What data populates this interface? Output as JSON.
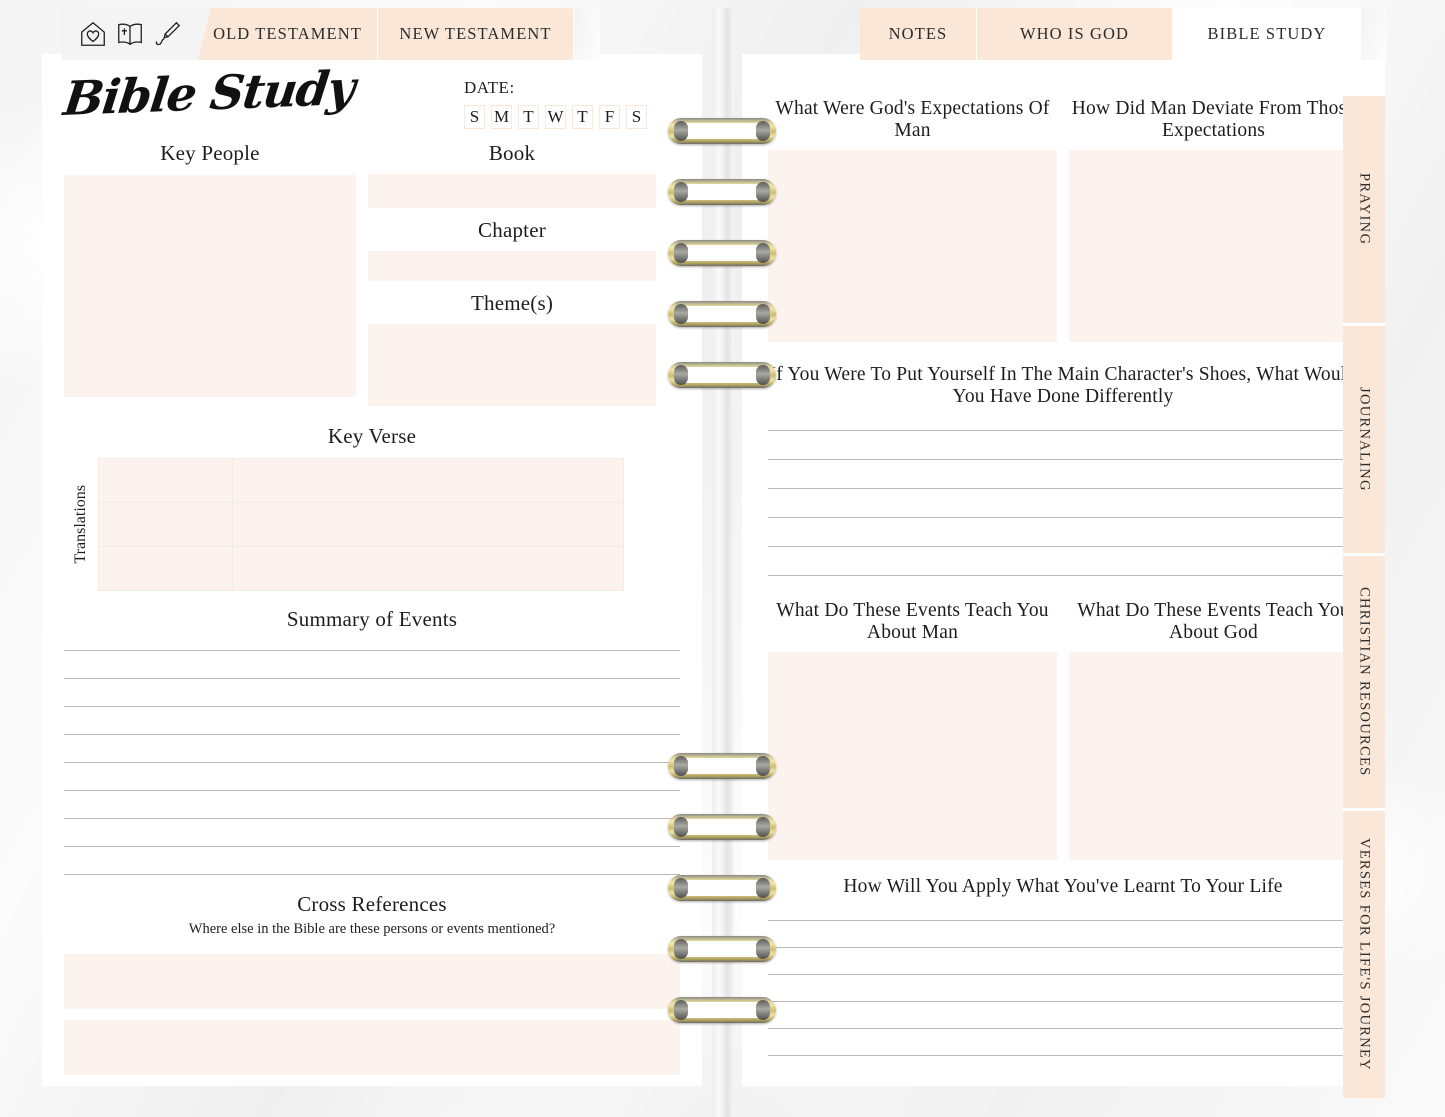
{
  "top_nav": {
    "icons": [
      {
        "name": "home-heart-icon",
        "label": "Home"
      },
      {
        "name": "bible-book-icon",
        "label": "Bible"
      },
      {
        "name": "fountain-pen-icon",
        "label": "Write"
      }
    ],
    "left_tabs": [
      {
        "label": "OLD TESTAMENT",
        "active": false
      },
      {
        "label": "NEW TESTAMENT",
        "active": false
      }
    ],
    "right_tabs": [
      {
        "label": "NOTES",
        "active": false
      },
      {
        "label": "WHO IS GOD",
        "active": false
      },
      {
        "label": "BIBLE STUDY",
        "active": true
      }
    ]
  },
  "side_tabs": [
    {
      "label": "PRAYING"
    },
    {
      "label": "JOURNALING"
    },
    {
      "label": "CHRISTIAN RESOURCES"
    },
    {
      "label": "VERSES FOR LIFE'S JOURNEY"
    }
  ],
  "left_page": {
    "title": "Bible Study",
    "date_label": "DATE:",
    "days": [
      "S",
      "M",
      "T",
      "W",
      "T",
      "F",
      "S"
    ],
    "key_people_label": "Key People",
    "book_label": "Book",
    "chapter_label": "Chapter",
    "themes_label": "Theme(s)",
    "key_verse_label": "Key Verse",
    "translations_label": "Translations",
    "summary_label": "Summary of Events",
    "cross_refs_label": "Cross References",
    "cross_refs_sub": "Where else in the Bible are these persons or events mentioned?"
  },
  "right_page": {
    "expectations_label": "What Were God's Expectations Of Man",
    "deviate_label": "How Did Man Deviate From Those Expectations",
    "shoes_label": "If You Were To Put Yourself In The Main Character's Shoes, What Would You Have Done Differently",
    "teach_man_label": "What Do These Events Teach You About Man",
    "teach_god_label": "What Do These Events Teach You About God",
    "apply_label": "How Will You Apply What You've Learnt To Your Life"
  },
  "theme": {
    "fill_peach": "#FDF3EE",
    "tab_peach": "#FBE7D8",
    "rule_gray": "#B9B9B9",
    "ink": "#1D1D1D",
    "paper": "#FFFFFF",
    "ring_gold": "#CDBD72"
  },
  "counts": {
    "ring_groups": 2,
    "rings_per_group": 5,
    "summary_lines": 9,
    "shoes_lines": 6,
    "apply_lines": 6,
    "translation_rows": 3
  }
}
